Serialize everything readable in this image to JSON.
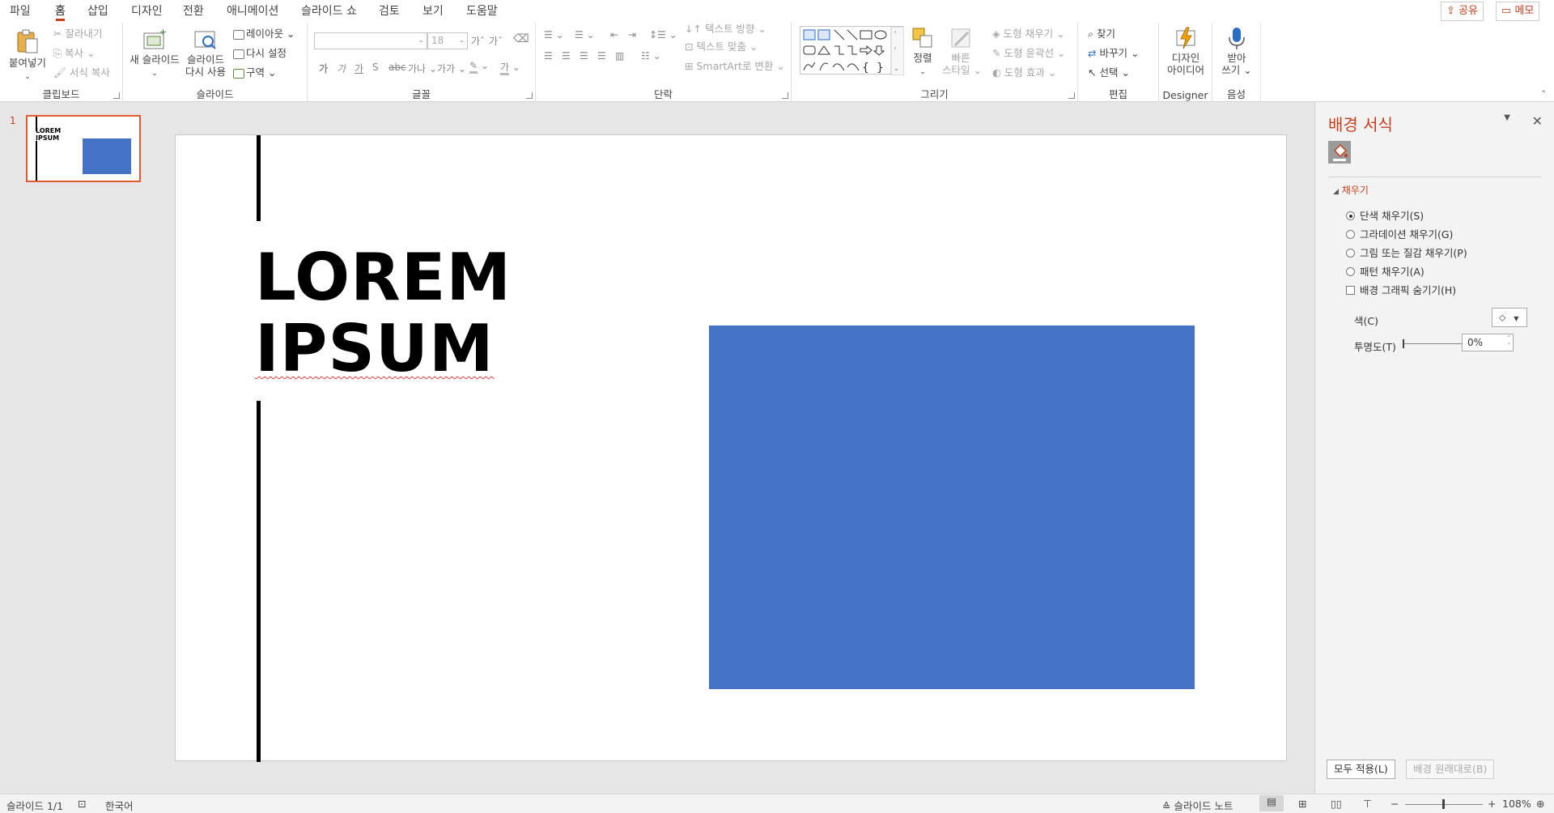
{
  "tabs": [
    {
      "id": "file",
      "label": "파일"
    },
    {
      "id": "home",
      "label": "홈"
    },
    {
      "id": "insert",
      "label": "삽입"
    },
    {
      "id": "design",
      "label": "디자인"
    },
    {
      "id": "transitions",
      "label": "전환"
    },
    {
      "id": "animations",
      "label": "애니메이션"
    },
    {
      "id": "slideshow",
      "label": "슬라이드 쇼"
    },
    {
      "id": "review",
      "label": "검토"
    },
    {
      "id": "view",
      "label": "보기"
    },
    {
      "id": "help",
      "label": "도움말"
    }
  ],
  "top_buttons": {
    "share": "공유",
    "comments": "메모"
  },
  "ribbon": {
    "clipboard": {
      "label": "클립보드",
      "paste": "붙여넣기",
      "cut": "잘라내기",
      "copy": "복사",
      "format_painter": "서식 복사"
    },
    "slides": {
      "label": "슬라이드",
      "new_slide": "새 슬라이드",
      "reuse_line1": "슬라이드",
      "reuse_line2": "다시 사용",
      "layout": "레이아웃",
      "reset": "다시 설정",
      "section": "구역"
    },
    "font": {
      "label": "글꼴",
      "size": "18",
      "grow": "가ˆ",
      "shrink": "가ˇ",
      "clear": "가",
      "bold": "가",
      "italic": "가",
      "underline": "가",
      "strike": "S",
      "spacing": "가나",
      "case": "가가",
      "highlight": "가",
      "color": "가"
    },
    "paragraph": {
      "label": "단락",
      "text_direction": "텍스트 방향",
      "align_text": "텍스트 맞춤",
      "smartart": "SmartArt로 변환"
    },
    "drawing": {
      "label": "그리기",
      "arrange": "정렬",
      "quick_styles_line1": "빠른",
      "quick_styles_line2": "스타일",
      "shape_fill": "도형 채우기",
      "shape_outline": "도형 윤곽선",
      "shape_effects": "도형 효과"
    },
    "editing": {
      "label": "편집",
      "find": "찾기",
      "replace": "바꾸기",
      "select": "선택"
    },
    "designer": {
      "label": "Designer",
      "ideas_line1": "디자인",
      "ideas_line2": "아이디어"
    },
    "voice": {
      "label": "음성",
      "dictate_line1": "받아",
      "dictate_line2": "쓰기"
    }
  },
  "thumbnails": [
    {
      "number": "1",
      "line1": "LOREM",
      "line2": "IPSUM"
    }
  ],
  "slide": {
    "title_line1": "LOREM",
    "title_line2": "IPSUM",
    "rect_color": "#4472c4"
  },
  "format_pane": {
    "title": "배경 서식",
    "section": "채우기",
    "options": [
      {
        "label": "단색 채우기(S)",
        "checked": true
      },
      {
        "label": "그라데이션 채우기(G)",
        "checked": false
      },
      {
        "label": "그림 또는 질감 채우기(P)",
        "checked": false
      },
      {
        "label": "패턴 채우기(A)",
        "checked": false
      }
    ],
    "hide_graphics": "배경 그래픽 숨기기(H)",
    "color_label": "색(C)",
    "transparency_label": "투명도(T)",
    "transparency_value": "0%",
    "transparency_percent": 0,
    "apply_all": "모두 적용(L)",
    "reset_background": "배경 원래대로(B)"
  },
  "status": {
    "slide_count": "슬라이드 1/1",
    "language": "한국어",
    "notes": "슬라이드 노트",
    "zoom": "108%"
  },
  "colors": {
    "accent": "#c43e1c",
    "slide_rect": "#4472c4"
  }
}
